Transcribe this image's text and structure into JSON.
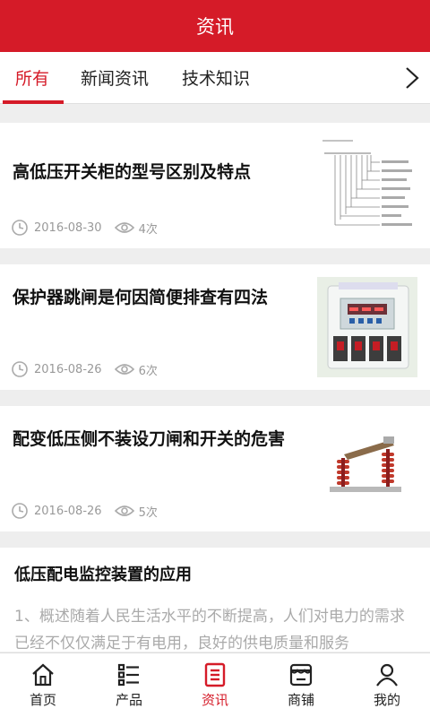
{
  "header": {
    "title": "资讯"
  },
  "tabs": {
    "items": [
      {
        "label": "所有",
        "active": true
      },
      {
        "label": "新闻资讯",
        "active": false
      },
      {
        "label": "技术知识",
        "active": false
      }
    ],
    "more_icon": "chevron-right-icon"
  },
  "articles": [
    {
      "title": "高低压开关柜的型号区别及特点",
      "date": "2016-08-30",
      "views": "4次",
      "thumbnail": "model-number-diagram"
    },
    {
      "title": "保护器跳闸是何因简便排查有四法",
      "date": "2016-08-26",
      "views": "6次",
      "thumbnail": "protector-device"
    },
    {
      "title": "配变低压侧不装设刀闸和开关的危害",
      "date": "2016-08-26",
      "views": "5次",
      "thumbnail": "disconnect-switch"
    },
    {
      "title": "低压配电监控装置的应用",
      "summary": "1、概述随着人民生活水平的不断提高，人们对电力的需求已经不仅仅满足于有电用，良好的供电质量和服务"
    }
  ],
  "bottom_nav": [
    {
      "label": "首页",
      "icon": "home-icon",
      "active": false
    },
    {
      "label": "产品",
      "icon": "list-icon",
      "active": false
    },
    {
      "label": "资讯",
      "icon": "document-icon",
      "active": true
    },
    {
      "label": "商铺",
      "icon": "shop-icon",
      "active": false
    },
    {
      "label": "我的",
      "icon": "user-icon",
      "active": false
    }
  ],
  "colors": {
    "accent": "#d51b28",
    "text": "#111111",
    "meta": "#999999",
    "background": "#eeeeee"
  }
}
